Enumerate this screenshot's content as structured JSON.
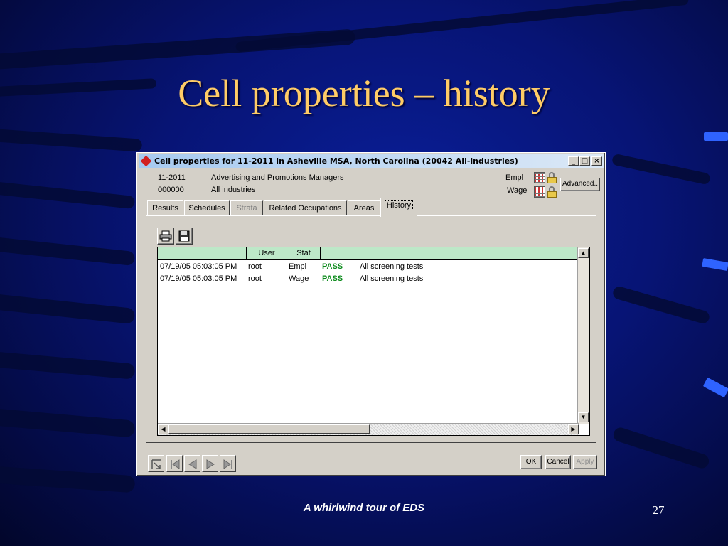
{
  "slide": {
    "title": "Cell properties – history",
    "footer": "A whirlwind tour of EDS",
    "page_number": "27"
  },
  "window": {
    "title": "Cell properties for 11-2011 in Asheville MSA, North Carolina (20042 All-industries)",
    "controls": {
      "minimize": "_",
      "maximize": "□",
      "close": "×"
    }
  },
  "info": {
    "occ_code": "11-2011",
    "occ_name": "Advertising and Promotions Managers",
    "ind_code": "000000",
    "ind_name": "All industries",
    "empl_label": "Empl",
    "wage_label": "Wage",
    "advanced_label": "Advanced.."
  },
  "tabs": [
    {
      "label": "Results",
      "state": "normal"
    },
    {
      "label": "Schedules",
      "state": "normal"
    },
    {
      "label": "Strata",
      "state": "disabled"
    },
    {
      "label": "Related Occupations",
      "state": "normal"
    },
    {
      "label": "Areas",
      "state": "normal"
    },
    {
      "label": "History",
      "state": "active"
    }
  ],
  "toolbar": {
    "print_icon": "printer-icon",
    "save_icon": "floppy-disk-icon"
  },
  "table": {
    "columns": [
      "",
      "User",
      "Stat",
      "",
      ""
    ],
    "rows": [
      [
        "07/19/05 05:03:05 PM",
        "root",
        "Empl",
        "PASS",
        "All screening tests"
      ],
      [
        "07/19/05 05:03:05 PM",
        "root",
        "Wage",
        "PASS",
        "All screening tests"
      ]
    ]
  },
  "buttons": {
    "ok": "OK",
    "cancel": "Cancel",
    "apply": "Apply"
  },
  "colors": {
    "title": "#ffcc66",
    "pass": "#0a8a1a",
    "header": "#bde8c8"
  }
}
